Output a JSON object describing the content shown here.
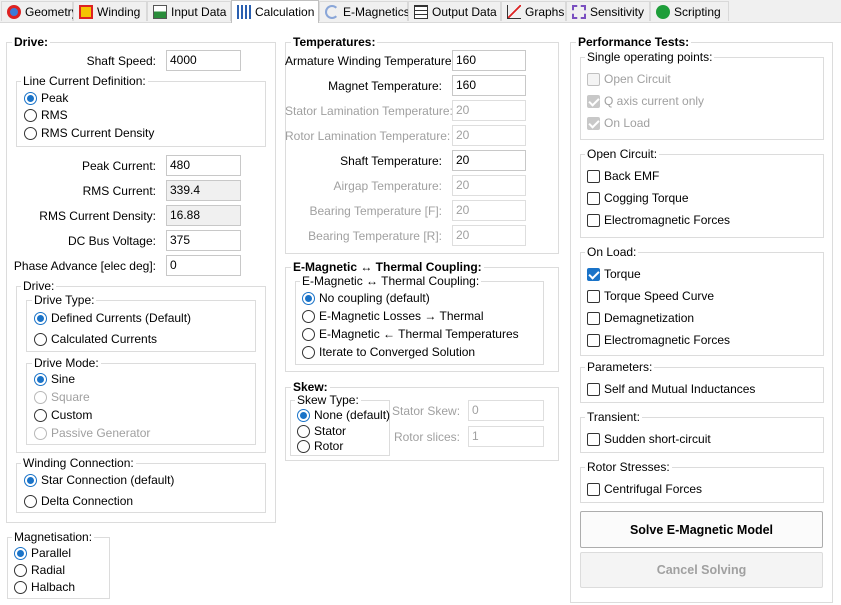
{
  "tabs": [
    {
      "label": "Geometry",
      "icon": "geometry-icon"
    },
    {
      "label": "Winding",
      "icon": "winding-icon"
    },
    {
      "label": "Input Data",
      "icon": "input-data-icon"
    },
    {
      "label": "Calculation",
      "icon": "calculation-icon"
    },
    {
      "label": "E-Magnetics",
      "icon": "emagnetics-icon"
    },
    {
      "label": "Output Data",
      "icon": "output-data-icon"
    },
    {
      "label": "Graphs",
      "icon": "graphs-icon"
    },
    {
      "label": "Sensitivity",
      "icon": "sensitivity-icon"
    },
    {
      "label": "Scripting",
      "icon": "scripting-icon"
    }
  ],
  "drive": {
    "title": "Drive:",
    "shaft_speed": {
      "label": "Shaft Speed:",
      "value": "4000"
    },
    "line_current_definition": {
      "title": "Line Current Definition:",
      "options": [
        "Peak",
        "RMS",
        "RMS Current Density"
      ]
    },
    "peak_current": {
      "label": "Peak Current:",
      "value": "480"
    },
    "rms_current": {
      "label": "RMS Current:",
      "value": "339.4"
    },
    "rms_current_density": {
      "label": "RMS Current Density:",
      "value": "16.88"
    },
    "dc_bus_voltage": {
      "label": "DC Bus Voltage:",
      "value": "375"
    },
    "phase_advance": {
      "label": "Phase Advance [elec deg]:",
      "value": "0"
    },
    "drive_group": {
      "title": "Drive:",
      "drive_type": {
        "title": "Drive Type:",
        "options": [
          "Defined Currents (Default)",
          "Calculated Currents"
        ]
      },
      "drive_mode": {
        "title": "Drive Mode:",
        "options": [
          "Sine",
          "Square",
          "Custom",
          "Passive Generator"
        ]
      }
    },
    "winding_connection": {
      "title": "Winding Connection:",
      "options": [
        "Star Connection (default)",
        "Delta Connection"
      ]
    }
  },
  "magnetisation": {
    "title": "Magnetisation:",
    "options": [
      "Parallel",
      "Radial",
      "Halbach"
    ]
  },
  "temperatures": {
    "title": "Temperatures:",
    "rows": [
      {
        "label": "Armature Winding Temperature:",
        "value": "160"
      },
      {
        "label": "Magnet Temperature:",
        "value": "160"
      },
      {
        "label": "Stator Lamination Temperature:",
        "value": "20"
      },
      {
        "label": "Rotor Lamination Temperature:",
        "value": "20"
      },
      {
        "label": "Shaft Temperature:",
        "value": "20"
      },
      {
        "label": "Airgap Temperature:",
        "value": "20"
      },
      {
        "label": "Bearing Temperature [F]:",
        "value": "20"
      },
      {
        "label": "Bearing Temperature [R]:",
        "value": "20"
      }
    ]
  },
  "coupling": {
    "title": "E-Magnetic ↔ Thermal Coupling:",
    "inner_title": "E-Magnetic ↔ Thermal Coupling:",
    "options": [
      "No coupling (default)",
      "E-Magnetic Losses → Thermal",
      "E-Magnetic  ← Thermal Temperatures",
      "Iterate to Converged Solution"
    ]
  },
  "skew": {
    "title": "Skew:",
    "type_title": "Skew Type:",
    "options": [
      "None (default)",
      "Stator",
      "Rotor"
    ],
    "stator_skew": {
      "label": "Stator Skew:",
      "value": "0"
    },
    "rotor_slices": {
      "label": "Rotor slices:",
      "value": "1"
    }
  },
  "performance": {
    "title": "Performance Tests:",
    "single": {
      "title": "Single operating points:",
      "items": [
        "Open Circuit",
        "Q axis current only",
        "On Load"
      ]
    },
    "open_circuit": {
      "title": "Open Circuit:",
      "items": [
        "Back EMF",
        "Cogging Torque",
        "Electromagnetic Forces"
      ]
    },
    "on_load": {
      "title": "On Load:",
      "items": [
        "Torque",
        "Torque Speed Curve",
        "Demagnetization",
        "Electromagnetic Forces"
      ]
    },
    "parameters": {
      "title": "Parameters:",
      "items": [
        "Self and Mutual Inductances"
      ]
    },
    "transient": {
      "title": "Transient:",
      "items": [
        "Sudden short-circuit"
      ]
    },
    "rotor_stresses": {
      "title": "Rotor Stresses:",
      "items": [
        "Centrifugal Forces"
      ]
    },
    "solve_label": "Solve E-Magnetic Model",
    "cancel_label": "Cancel Solving"
  },
  "colors": {
    "accent": "#1a73c8",
    "disabled_text": "#a0a0a0"
  }
}
